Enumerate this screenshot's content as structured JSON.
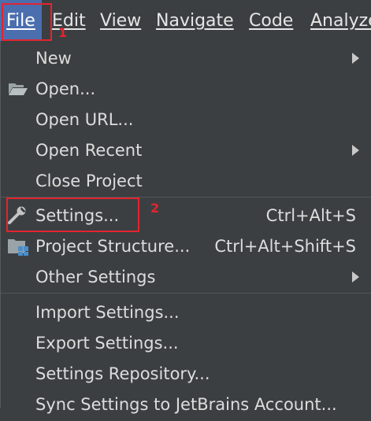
{
  "menubar": {
    "items": [
      {
        "label": "File"
      },
      {
        "label": "Edit"
      },
      {
        "label": "View"
      },
      {
        "label": "Navigate"
      },
      {
        "label": "Code"
      },
      {
        "label": "Analyze"
      }
    ]
  },
  "menu": {
    "items": [
      {
        "label": "New",
        "has_submenu": true
      },
      {
        "label": "Open...",
        "icon": "folder-open-icon"
      },
      {
        "label": "Open URL..."
      },
      {
        "label": "Open Recent",
        "has_submenu": true
      },
      {
        "label": "Close Project"
      },
      {
        "label": "Settings...",
        "shortcut": "Ctrl+Alt+S",
        "icon": "wrench-icon"
      },
      {
        "label": "Project Structure...",
        "shortcut": "Ctrl+Alt+Shift+S",
        "icon": "project-structure-icon"
      },
      {
        "label": "Other Settings",
        "has_submenu": true
      },
      {
        "label": "Import Settings..."
      },
      {
        "label": "Export Settings..."
      },
      {
        "label": "Settings Repository..."
      },
      {
        "label": "Sync Settings to JetBrains Account..."
      }
    ]
  },
  "annotations": [
    {
      "number": "1"
    },
    {
      "number": "2"
    }
  ],
  "colors": {
    "background": "#3c3f41",
    "selection": "#4b6eaf",
    "annotation": "#e2242f",
    "text": "#dddddd"
  }
}
